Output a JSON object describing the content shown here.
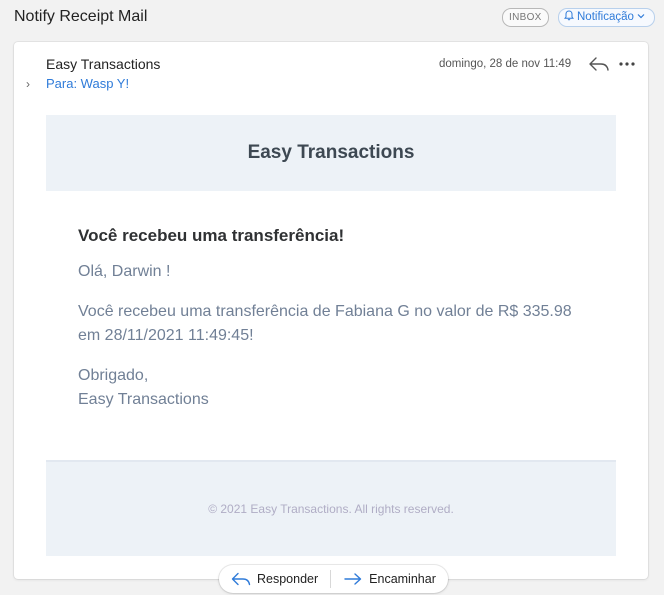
{
  "header": {
    "subject": "Notify Receipt Mail",
    "mailbox_tag": "INBOX",
    "category_tag": "Notificação"
  },
  "message": {
    "sender": "Easy Transactions",
    "date": "domingo, 28 de nov 11:49",
    "recipient": "Para: Wasp Y!",
    "banner_title": "Easy Transactions",
    "heading": "Você recebeu uma transferência!",
    "greeting": "Olá, Darwin !",
    "body": "Você recebeu uma transferência de Fabiana G no valor de R$ 335.98 em 28/11/2021 11:49:45!",
    "closing": "Obrigado,",
    "signature": "Easy Transactions",
    "footer": "© 2021 Easy Transactions. All rights reserved."
  },
  "actions": {
    "reply": "Responder",
    "forward": "Encaminhar"
  },
  "colors": {
    "accent": "#2f7bd9",
    "banner_bg": "#edf2f7"
  },
  "icons": [
    "bell-icon",
    "chevron-down-icon",
    "reply-icon",
    "more-icon",
    "chevron-right-icon",
    "forward-icon"
  ]
}
